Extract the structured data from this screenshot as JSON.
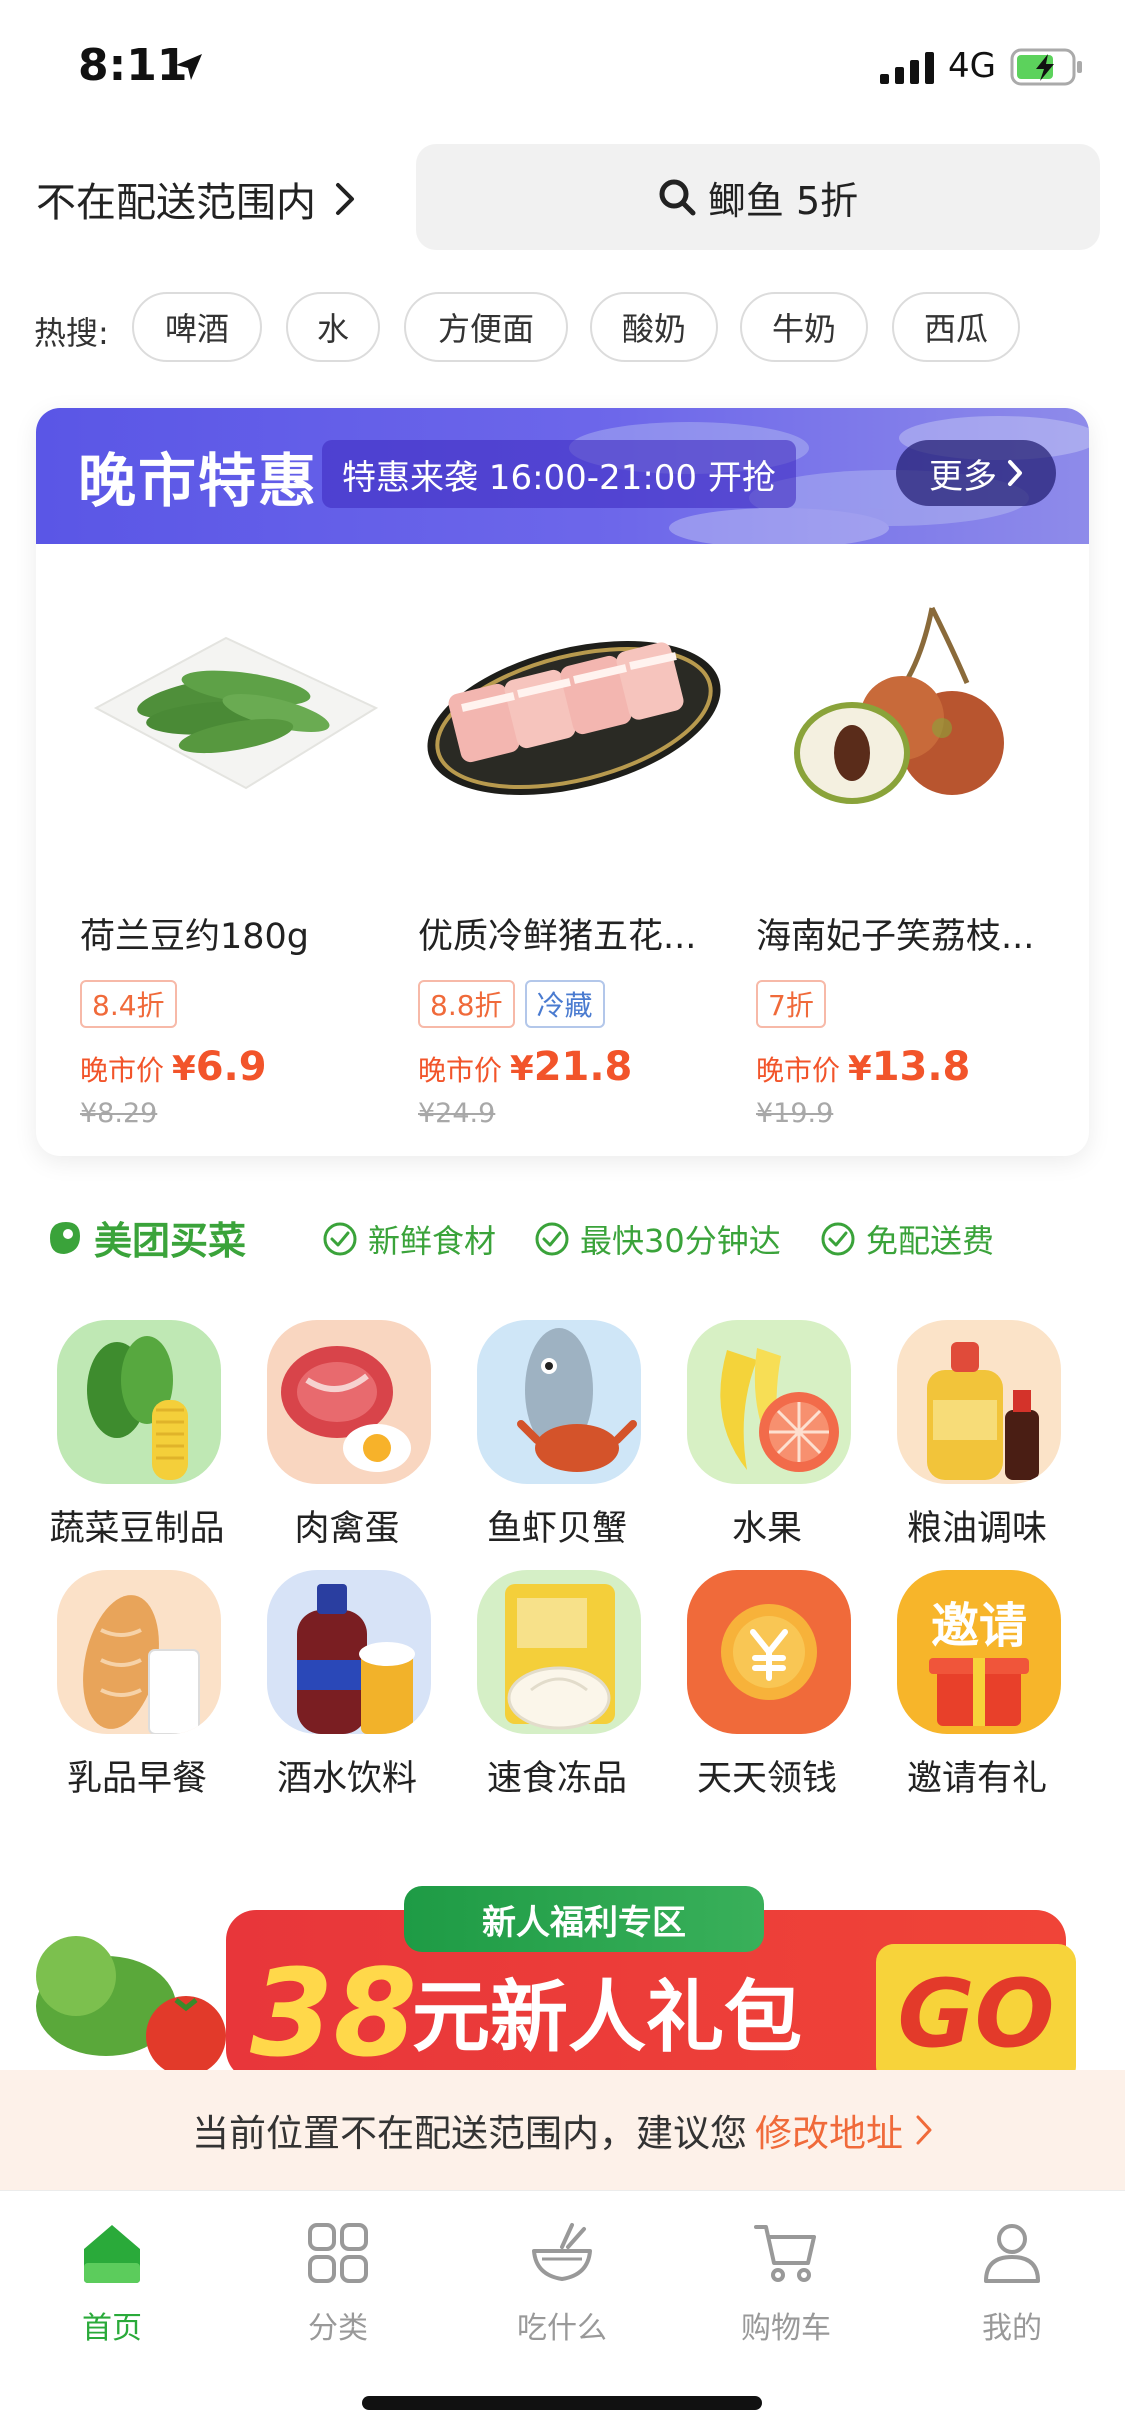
{
  "status_bar": {
    "time": "8:11",
    "network": "4G"
  },
  "header": {
    "location": "不在配送范围内",
    "search_text": "鲫鱼 5折"
  },
  "hot_search": {
    "label": "热搜:",
    "tags": [
      "啤酒",
      "水",
      "方便面",
      "酸奶",
      "牛奶",
      "西瓜"
    ]
  },
  "evening_market": {
    "title": "晚市特惠",
    "subtitle": "特惠来袭 16:00-21:00 开抢",
    "more": "更多",
    "products": [
      {
        "name": "荷兰豆约180g",
        "discount": "8.4折",
        "cold": "",
        "price_label": "晚市价",
        "currency": "¥",
        "price": "6.9",
        "original": "¥8.29"
      },
      {
        "name": "优质冷鲜猪五花...",
        "discount": "8.8折",
        "cold": "冷藏",
        "price_label": "晚市价",
        "currency": "¥",
        "price": "21.8",
        "original": "¥24.9"
      },
      {
        "name": "海南妃子笑荔枝...",
        "discount": "7折",
        "cold": "",
        "price_label": "晚市价",
        "currency": "¥",
        "price": "13.8",
        "original": "¥19.9"
      }
    ]
  },
  "brand": {
    "name": "美团买菜",
    "features": [
      "新鲜食材",
      "最快30分钟达",
      "免配送费"
    ]
  },
  "categories": [
    {
      "label": "蔬菜豆制品",
      "icon": "vegetables-icon"
    },
    {
      "label": "肉禽蛋",
      "icon": "meat-egg-icon"
    },
    {
      "label": "鱼虾贝蟹",
      "icon": "seafood-icon"
    },
    {
      "label": "水果",
      "icon": "fruit-icon"
    },
    {
      "label": "粮油调味",
      "icon": "oil-seasoning-icon"
    },
    {
      "label": "乳品早餐",
      "icon": "dairy-breakfast-icon"
    },
    {
      "label": "酒水饮料",
      "icon": "drinks-icon"
    },
    {
      "label": "速食冻品",
      "icon": "frozen-food-icon"
    },
    {
      "label": "天天领钱",
      "icon": "coin-icon"
    },
    {
      "label": "邀请有礼",
      "icon": "invite-gift-icon",
      "icon_text": "邀请"
    }
  ],
  "promo": {
    "tag": "新人福利专区",
    "amount": "38",
    "text": "元新人礼包",
    "go": "GO"
  },
  "notice": {
    "text": "当前位置不在配送范围内，建议您",
    "link": "修改地址"
  },
  "tabbar": {
    "tabs": [
      {
        "label": "首页",
        "icon": "home-icon",
        "active": true
      },
      {
        "label": "分类",
        "icon": "grid-icon",
        "active": false
      },
      {
        "label": "吃什么",
        "icon": "bowl-icon",
        "active": false
      },
      {
        "label": "购物车",
        "icon": "cart-icon",
        "active": false
      },
      {
        "label": "我的",
        "icon": "user-icon",
        "active": false
      }
    ]
  },
  "colors": {
    "brand_green": "#3aa33a",
    "price_orange": "#f2542a",
    "evening_purple": "#5a56e6",
    "promo_red": "#e8363a"
  }
}
